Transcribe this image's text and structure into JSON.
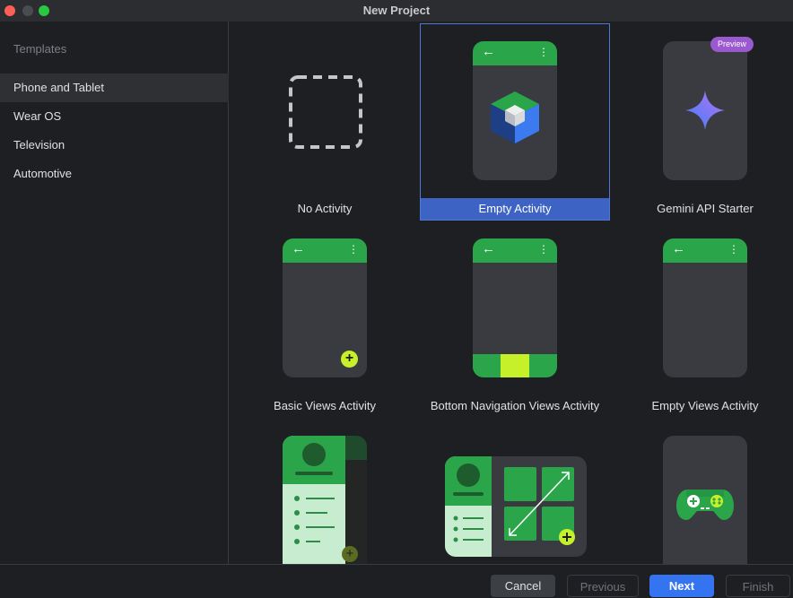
{
  "window": {
    "title": "New Project"
  },
  "sidebar": {
    "heading": "Templates",
    "items": [
      {
        "label": "Phone and Tablet"
      },
      {
        "label": "Wear OS"
      },
      {
        "label": "Television"
      },
      {
        "label": "Automotive"
      }
    ],
    "selected": "Phone and Tablet"
  },
  "templates": [
    {
      "label": "No Activity",
      "icon": "dashed-square-icon"
    },
    {
      "label": "Empty Activity",
      "icon": "android-studio-cube-icon",
      "selected": true
    },
    {
      "label": "Gemini API Starter",
      "icon": "gemini-sparkle-icon",
      "badge": "Preview"
    },
    {
      "label": "Basic Views Activity",
      "icon": "phone-fab-icon"
    },
    {
      "label": "Bottom Navigation Views Activity",
      "icon": "phone-bottom-nav-icon"
    },
    {
      "label": "Empty Views Activity",
      "icon": "phone-empty-icon"
    },
    {
      "label": "",
      "icon": "navigation-drawer-phone-icon"
    },
    {
      "label": "",
      "icon": "responsive-tablet-icon"
    },
    {
      "label": "",
      "icon": "game-controller-icon"
    }
  ],
  "footer": {
    "cancel": "Cancel",
    "previous": "Previous",
    "next": "Next",
    "finish": "Finish"
  },
  "colors": {
    "accent": "#3574f0",
    "selection": "#3d64c4",
    "android_green": "#2aa54a",
    "lime": "#c6f12a",
    "preview_badge": "#9b59d0"
  }
}
